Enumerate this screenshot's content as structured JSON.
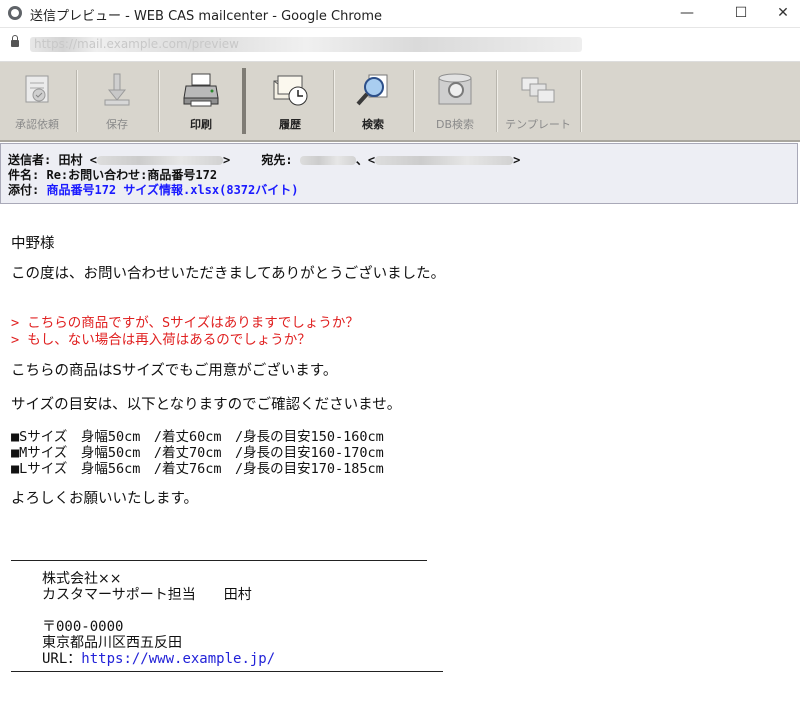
{
  "window": {
    "title": "送信プレビュー - WEB CAS mailcenter - Google Chrome",
    "minimize": "—",
    "maximize": "☐",
    "close": "✕"
  },
  "address_bar": {
    "url": "https://mail.example.com/preview"
  },
  "toolbar": {
    "buttons": [
      {
        "label": "承認依頼",
        "icon": "approval-request-icon",
        "enabled": false
      },
      {
        "label": "保存",
        "icon": "save-icon",
        "enabled": false
      },
      {
        "label": "印刷",
        "icon": "printer-icon",
        "enabled": true
      },
      {
        "label": "履歴",
        "icon": "history-icon",
        "enabled": true
      },
      {
        "label": "検索",
        "icon": "search-icon",
        "enabled": true
      },
      {
        "label": "DB検索",
        "icon": "database-search-icon",
        "enabled": false
      },
      {
        "label": "テンプレート",
        "icon": "template-icon",
        "enabled": false
      }
    ]
  },
  "header": {
    "from_label": "送信者:",
    "from_name": "田村",
    "to_label": "宛先:",
    "subject_label": "件名:",
    "subject": "Re:お問い合わせ:商品番号172",
    "attachment_label": "添付:",
    "attachment": "商品番号172 サイズ情報.xlsx(8372バイト)"
  },
  "body": {
    "greeting": "中野様",
    "thanks": "この度は、お問い合わせいただきましてありがとうございました。",
    "quote1": "> こちらの商品ですが、Sサイズはありますでしょうか？",
    "quote2": "> もし、ない場合は再入荷はあるのでしょうか？",
    "answer1": "こちらの商品はSサイズでもご用意がございます。",
    "answer2": "サイズの目安は、以下となりますのでご確認くださいませ。",
    "sizes": [
      "■Sサイズ　身幅50cm　/着丈60cm　/身長の目安150-160cm",
      "■Mサイズ　身幅50cm　/着丈70cm　/身長の目安160-170cm",
      "■Lサイズ　身幅56cm　/着丈76cm　/身長の目安170-185cm"
    ],
    "closing": "よろしくお願いいたします。"
  },
  "signature": {
    "company": "株式会社××",
    "dept": "カスタマーサポート担当　　田村",
    "zip": "〒000-0000",
    "address": "東京都品川区西五反田",
    "url_label": "URL：",
    "url": "https://www.example.jp/"
  },
  "colors": {
    "quote": "#e02020",
    "attachment": "#1a1aff",
    "link": "#2323d8",
    "toolbar_bg": "#d8d5cd"
  }
}
